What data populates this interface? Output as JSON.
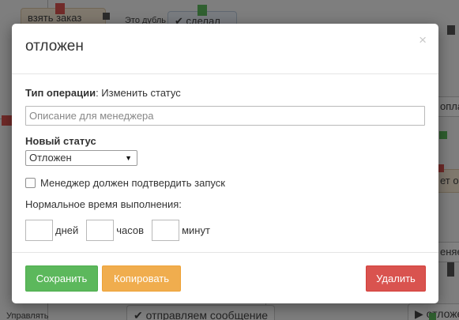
{
  "background": {
    "nodes": [
      {
        "id": "take-order",
        "text": "взять заказ"
      },
      {
        "id": "partial-top",
        "text": "Это дубль"
      },
      {
        "id": "done",
        "text": "✔ сделал"
      },
      {
        "id": "right-payment",
        "text": "оплач"
      },
      {
        "id": "right-op",
        "text": "ет опе"
      },
      {
        "id": "right-change",
        "text": "еняем"
      },
      {
        "id": "bottom-left",
        "text": "Управлять"
      },
      {
        "id": "send-message",
        "text": "✔ отправляем сообщение"
      },
      {
        "id": "postponed",
        "text": "▶ отложе"
      }
    ]
  },
  "modal": {
    "title": "отложен",
    "close_label": "×",
    "operation_type_label": "Тип операции",
    "operation_type_value": ": Изменить статус",
    "description_placeholder": "Описание для менеджера",
    "description_value": "",
    "new_status_label": "Новый статус",
    "status_selected": "Отложен",
    "status_arrow": "▼",
    "manager_confirm_label": "Менеджер должен подтвердить запуск",
    "manager_confirm_checked": false,
    "normal_time_label": "Нормальное время выполнения:",
    "duration": {
      "days_value": "",
      "days_unit": "дней",
      "hours_value": "",
      "hours_unit": "часов",
      "minutes_value": "",
      "minutes_unit": "минут"
    },
    "footer": {
      "save_label": "Сохранить",
      "copy_label": "Копировать",
      "delete_label": "Удалить"
    }
  },
  "colors": {
    "save": "#5cb85c",
    "copy": "#f0ad4e",
    "delete": "#d9534f",
    "overlay": "rgba(0,0,0,0.48)"
  }
}
